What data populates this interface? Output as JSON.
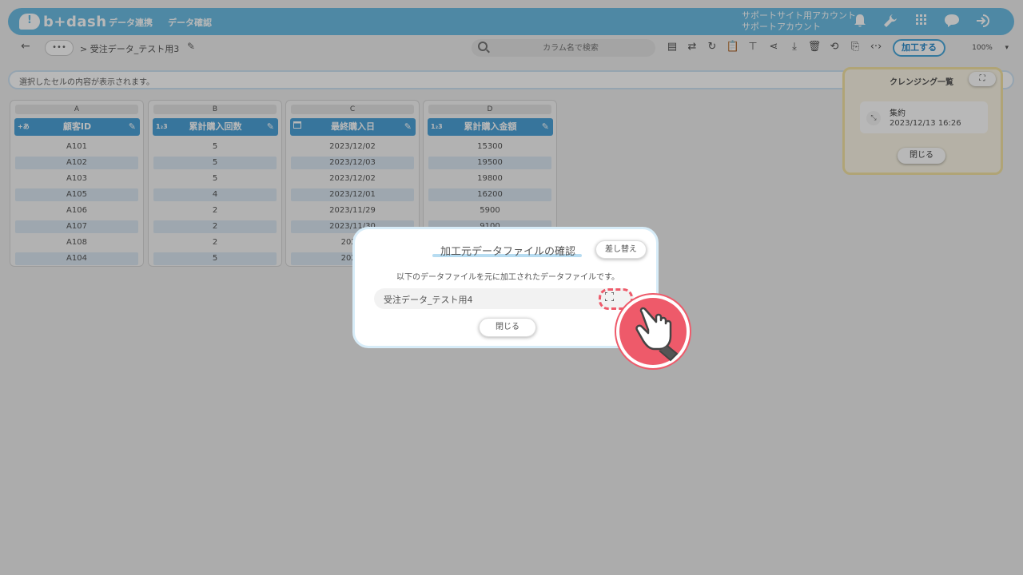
{
  "header": {
    "logo": "b+dash",
    "nav": [
      "データ連携",
      "データ確認"
    ],
    "account": [
      "サポートサイト用アカウント",
      "サポートアカウント"
    ]
  },
  "toolbar": {
    "more": "•••",
    "breadcrumb": "> 受注データ_テスト用3",
    "search_placeholder": "カラム名で検索",
    "process_label": "加工する",
    "zoom": "100%"
  },
  "cellbar": {
    "text": "選択したセルの内容が表示されます。"
  },
  "columns": [
    {
      "letter": "A",
      "type": "+あ",
      "name": "顧客ID",
      "cells": [
        "A101",
        "A102",
        "A103",
        "A105",
        "A106",
        "A107",
        "A108",
        "A104"
      ]
    },
    {
      "letter": "B",
      "type": "1₂3",
      "name": "累計購入回数",
      "cells": [
        "5",
        "5",
        "5",
        "4",
        "2",
        "2",
        "2",
        "5"
      ]
    },
    {
      "letter": "C",
      "type": "cal",
      "name": "最終購入日",
      "cells": [
        "2023/12/02",
        "2023/12/03",
        "2023/12/02",
        "2023/12/01",
        "2023/11/29",
        "2023/11/30",
        "2023/",
        "2023/"
      ]
    },
    {
      "letter": "D",
      "type": "1₂3",
      "name": "累計購入金額",
      "cells": [
        "15300",
        "19500",
        "19800",
        "16200",
        "5900",
        "9100",
        "",
        ""
      ]
    }
  ],
  "cleansing_panel": {
    "title": "クレンジング一覧",
    "expand": "⛶",
    "item_name": "集約",
    "item_date": "2023/12/13 16:26",
    "close": "閉じる"
  },
  "modal": {
    "title": "加工元データファイルの確認",
    "swap": "差し替え",
    "description": "以下のデータファイルを元に加工されたデータファイルです。",
    "file_name": "受注データ_テスト用4",
    "close": "閉じる"
  },
  "colors": {
    "brand": "#6cbde3",
    "column_header": "#4da3d8",
    "highlight": "#ee5a6a"
  }
}
